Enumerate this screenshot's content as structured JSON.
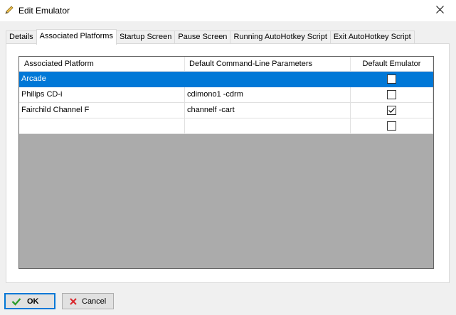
{
  "window": {
    "title": "Edit Emulator",
    "icon": "pencil-icon",
    "close_icon": "close-icon"
  },
  "tabs": [
    {
      "label": "Details",
      "active": false
    },
    {
      "label": "Associated Platforms",
      "active": true
    },
    {
      "label": "Startup Screen",
      "active": false
    },
    {
      "label": "Pause Screen",
      "active": false
    },
    {
      "label": "Running AutoHotkey Script",
      "active": false
    },
    {
      "label": "Exit AutoHotkey Script",
      "active": false
    }
  ],
  "grid": {
    "columns": [
      "Associated Platform",
      "Default Command-Line Parameters",
      "Default Emulator"
    ],
    "rows": [
      {
        "platform": "Arcade",
        "params": "",
        "default": false,
        "selected": true
      },
      {
        "platform": "Philips CD-i",
        "params": "cdimono1 -cdrm",
        "default": false,
        "selected": false
      },
      {
        "platform": "Fairchild Channel F",
        "params": "channelf -cart",
        "default": true,
        "selected": false
      },
      {
        "platform": "",
        "params": "",
        "default": false,
        "selected": false
      }
    ]
  },
  "buttons": {
    "ok_label": "OK",
    "ok_icon": "checkmark-icon",
    "cancel_label": "Cancel",
    "cancel_icon": "red-x-icon"
  },
  "colors": {
    "selection": "#0078d7",
    "grid_background": "#ababab",
    "ok_check": "#2e9d2e",
    "cancel_x": "#d9262b"
  }
}
